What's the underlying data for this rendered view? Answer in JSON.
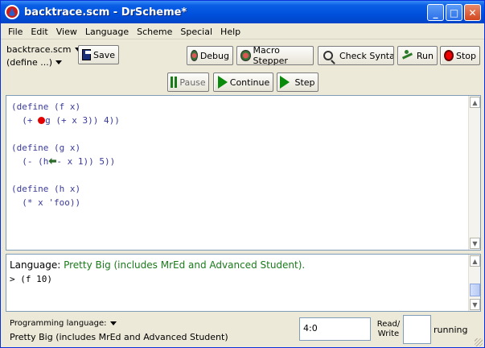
{
  "window": {
    "title": "backtrace.scm - DrScheme*",
    "controls": {
      "minimize": "_",
      "maximize": "□",
      "close": "✕"
    }
  },
  "menu": [
    "File",
    "Edit",
    "View",
    "Language",
    "Scheme",
    "Special",
    "Help"
  ],
  "toolbar": {
    "file_name": "backtrace.scm",
    "define_popup": "(define ...)",
    "save": "Save",
    "debug": "Debug",
    "macro_stepper": "Macro Stepper",
    "check_syntax": "Check Syntax",
    "run": "Run",
    "stop": "Stop"
  },
  "debugger": {
    "pause": "Pause",
    "continue": "Continue",
    "step": "Step"
  },
  "editor": {
    "line1": "(define (f x)",
    "line2_pre": "  (+ ",
    "line2_post": "g (+ x 3)) 4))",
    "line3": "",
    "line4": "(define (g x)",
    "line5_pre": "  (- (h",
    "line5_post": "- x 1)) 5))",
    "line6": "",
    "line7": "(define (h x)",
    "line8": "  (* x 'foo))"
  },
  "interactions": {
    "language_label": "Language:",
    "language_value": "Pretty Big (includes MrEd and Advanced Student).",
    "prompt": "> (f 10)"
  },
  "status": {
    "programming_language_label": "Programming language:",
    "programming_language": "Pretty Big (includes MrEd and Advanced Student)",
    "position": "4:0",
    "read_write": "Read/ Write",
    "running": "running"
  },
  "colors": {
    "title_bar": "#0050dc",
    "breakpoint": "#e00000",
    "language_text": "#1a7a1a"
  }
}
